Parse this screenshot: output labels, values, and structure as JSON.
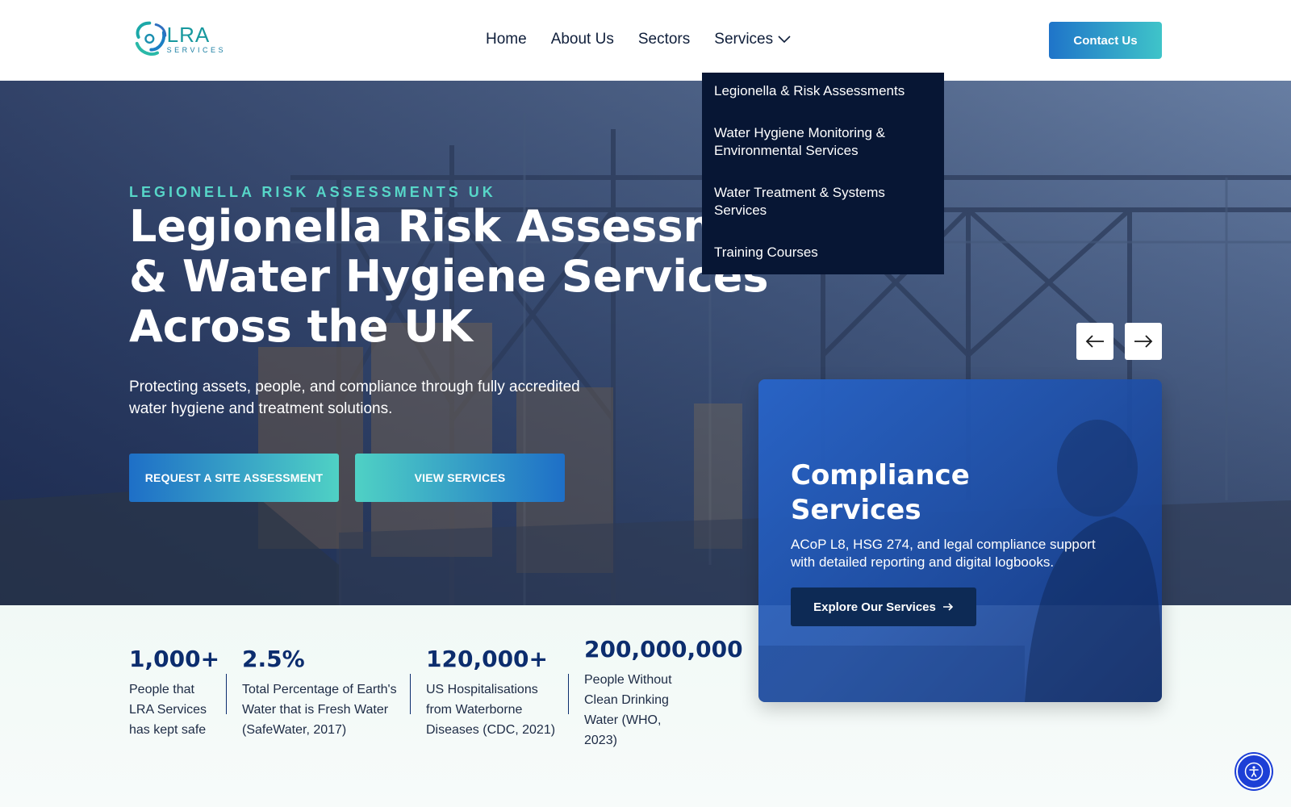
{
  "brand": {
    "logo_main": "LRA",
    "logo_sub": "SERVICES",
    "accent": "#3fc4c9",
    "primary": "#1f74c9",
    "navy": "#071634"
  },
  "nav": {
    "items": [
      {
        "label": "Home"
      },
      {
        "label": "About Us"
      },
      {
        "label": "Sectors"
      },
      {
        "label": "Services"
      }
    ],
    "contact_label": "Contact Us"
  },
  "dropdown": {
    "items": [
      {
        "label": "Legionella & Risk Assessments"
      },
      {
        "label": "Water Hygiene Monitoring & Environmental Services"
      },
      {
        "label": "Water Treatment & Systems Services"
      },
      {
        "label": "Training Courses"
      }
    ]
  },
  "hero": {
    "eyebrow": "LEGIONELLA RISK ASSESSMENTS UK",
    "title": "Legionella Risk Assessment & Water Hygiene Services Across the UK",
    "subtitle": "Protecting assets, people, and compliance through fully accredited water hygiene and treatment solutions.",
    "primary_button": "REQUEST A SITE ASSESSMENT",
    "secondary_button": "VIEW SERVICES"
  },
  "card": {
    "title": "Compliance Services",
    "text": "ACoP L8, HSG 274, and legal compliance support with detailed reporting and digital logbooks.",
    "button": "Explore Our Services"
  },
  "stats": [
    {
      "value": "1,000+",
      "label": "People that LRA Services has kept safe"
    },
    {
      "value": "2.5%",
      "label": "Total Percentage of Earth's Water that is Fresh Water (SafeWater, 2017)"
    },
    {
      "value": "120,000+",
      "label": "US Hospitalisations from Waterborne Diseases (CDC, 2021)"
    },
    {
      "value": "200,000,000",
      "label": "People Without Clean Drinking Water (WHO, 2023)"
    }
  ],
  "icons": {
    "prev": "arrow-left-icon",
    "next": "arrow-right-icon",
    "accessibility": "accessibility-icon",
    "chevron": "chevron-down-icon"
  }
}
